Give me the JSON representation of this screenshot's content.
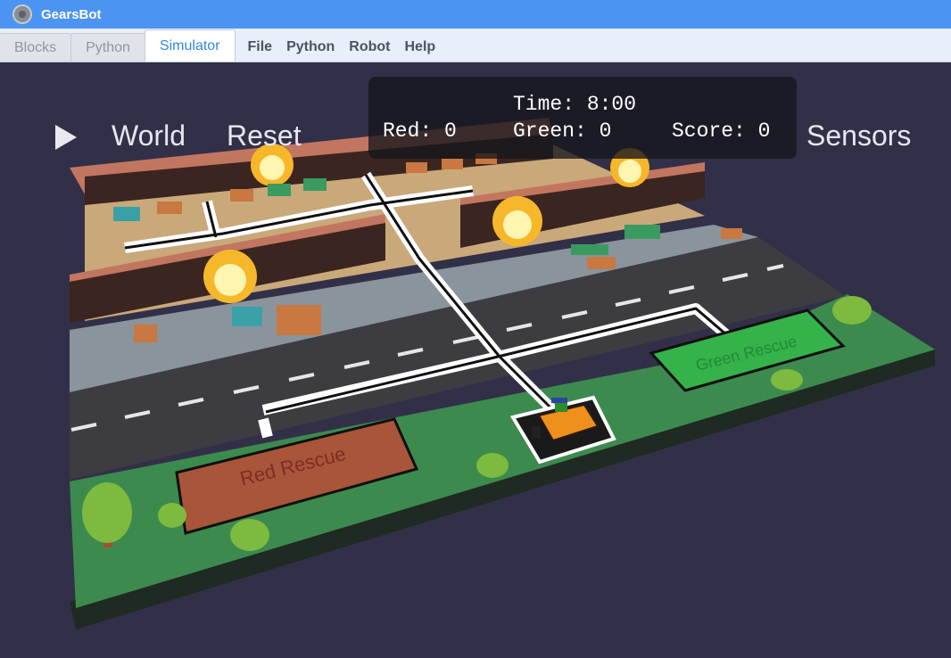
{
  "app": {
    "title": "GearsBot",
    "logo_icon": "gear-icon"
  },
  "tabs": [
    {
      "label": "Blocks",
      "active": false
    },
    {
      "label": "Python",
      "active": false
    },
    {
      "label": "Simulator",
      "active": true
    }
  ],
  "menu": {
    "file": "File",
    "python": "Python",
    "robot": "Robot",
    "help": "Help"
  },
  "sim": {
    "play_icon": "play-icon",
    "world_label": "World",
    "reset_label": "Reset",
    "sensors_label": "Sensors",
    "hud": {
      "time": "Time: 8:00",
      "red": "Red: 0",
      "green": "Green: 0",
      "score": "Score: 0"
    },
    "zones": {
      "red": "Red Rescue",
      "green": "Green Rescue"
    }
  },
  "colors": {
    "titlebar": "#4c94f2",
    "background": "#323048",
    "grass": "#3d8a4e",
    "road": "#3c3c40",
    "red_zone": "#a8553a",
    "green_zone": "#35b24a",
    "robot": "#f0901c"
  }
}
